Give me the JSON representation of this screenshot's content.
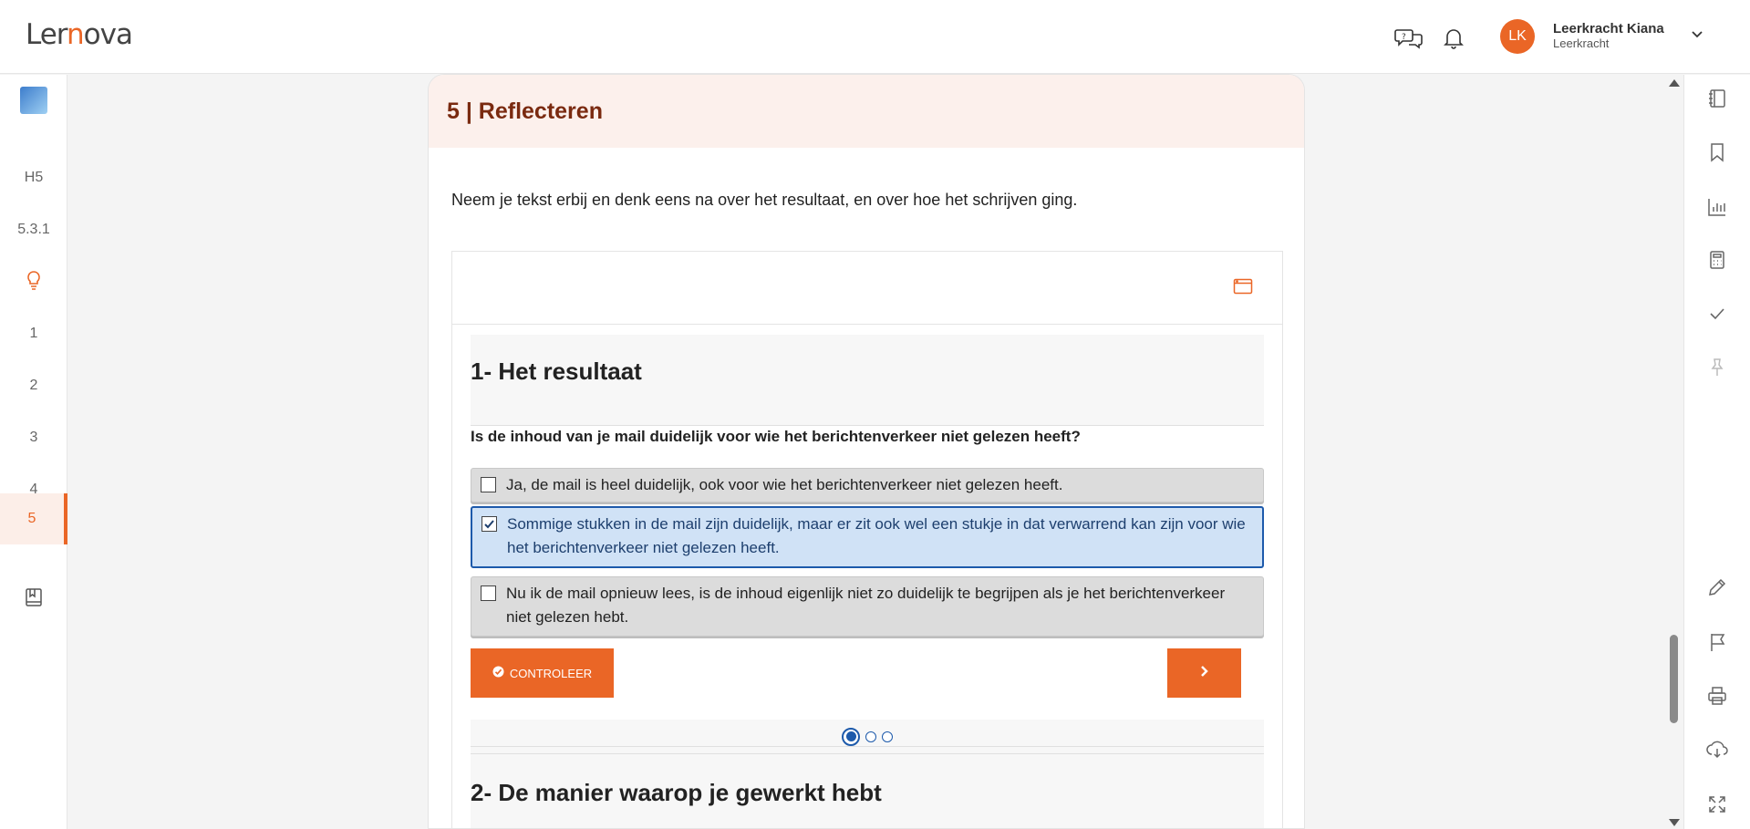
{
  "app": {
    "logo_text_a": "Ler",
    "logo_text_dot": "n",
    "logo_text_b": "ova"
  },
  "header": {
    "user_initials": "LK",
    "user_name": "Leerkracht Kiana",
    "user_role": "Leerkracht",
    "icons": [
      "chat-icon",
      "bell-icon",
      "chevron-down-icon"
    ]
  },
  "leftnav": {
    "items": [
      {
        "label": "H5"
      },
      {
        "label": "5.3.1"
      },
      {
        "label": "",
        "icon": "lightbulb-icon"
      },
      {
        "label": "1"
      },
      {
        "label": "2"
      },
      {
        "label": "3"
      },
      {
        "label": "4"
      },
      {
        "label": "5",
        "active": true
      },
      {
        "label": "",
        "icon": "book-icon"
      }
    ]
  },
  "rightnav": {
    "icons": [
      "notebook-icon",
      "bookmark-icon",
      "chart-icon",
      "calculator-icon",
      "check-icon",
      "pin-icon",
      "pencil-icon",
      "flag-icon",
      "print-icon",
      "cloud-download-icon",
      "fullscreen-icon"
    ]
  },
  "section": {
    "title": "5 | Reflecteren",
    "intro": "Neem je tekst erbij en denk eens na over het resultaat, en over hoe het schrijven ging."
  },
  "exercise": {
    "q1_title": "1- Het resultaat",
    "q1_question": "Is de inhoud van je mail duidelijk voor wie het berichtenverkeer niet gelezen heeft?",
    "options": [
      {
        "text": "Ja, de mail is heel duidelijk, ook voor wie het berichtenverkeer niet gelezen heeft.",
        "checked": false
      },
      {
        "text": "Sommige stukken in de mail zijn duidelijk, maar er zit ook wel een stukje in dat verwarrend kan zijn voor wie het berichtenverkeer niet gelezen heeft.",
        "checked": true
      },
      {
        "text": "Nu ik de mail opnieuw lees, is de inhoud eigenlijk niet zo duidelijk te begrijpen als je het berichtenverkeer niet gelezen hebt.",
        "checked": false
      }
    ],
    "check_label": "CONTROLEER",
    "pager": {
      "current": 1,
      "total": 3
    },
    "q2_title": "2- De manier waarop je gewerkt hebt"
  },
  "colors": {
    "accent": "#ea6626",
    "selected_border": "#1d5aab",
    "selected_bg": "#d0e2f6"
  }
}
